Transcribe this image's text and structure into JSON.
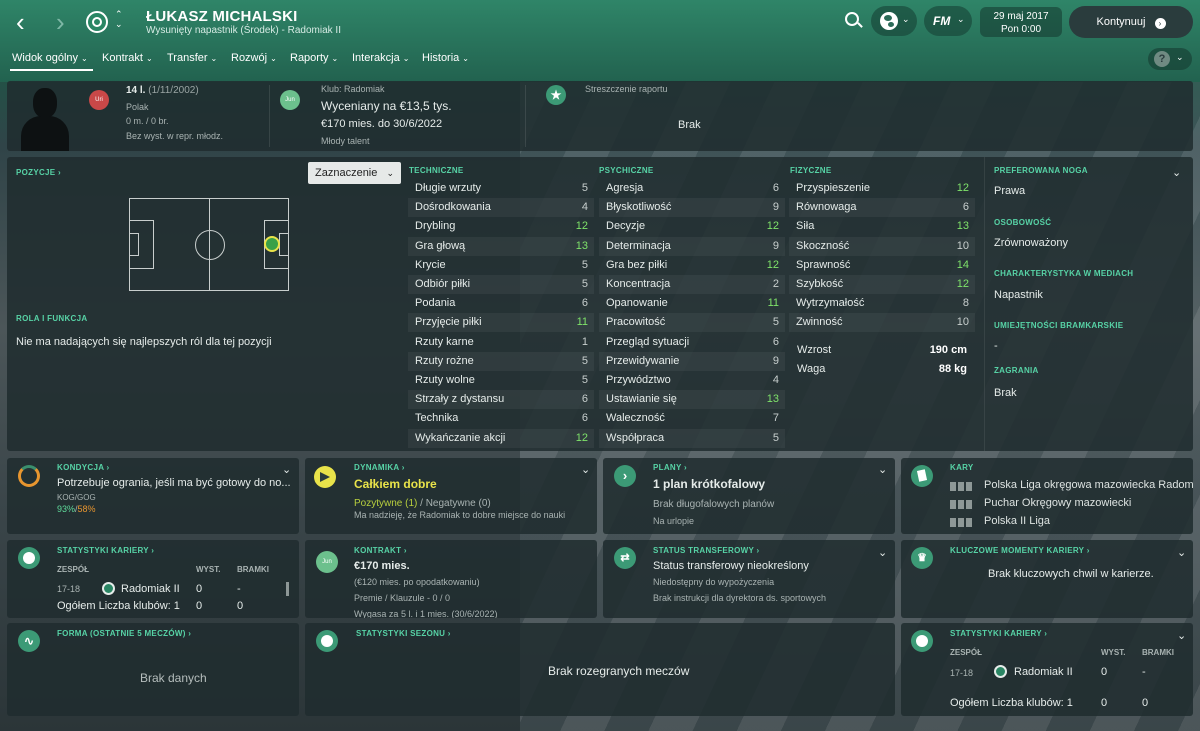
{
  "header": {
    "player_name": "ŁUKASZ MICHALSKI",
    "player_sub": "Wysunięty napastnik (Środek) - Radomiak II",
    "date_line1": "29 maj 2017",
    "date_line2": "Pon 0:00",
    "continue_label": "Kontynuuj",
    "fm_label": "FM"
  },
  "tabs": [
    "Widok ogólny",
    "Kontrakt",
    "Transfer",
    "Rozwój",
    "Raporty",
    "Interakcja",
    "Historia"
  ],
  "help_label": "?",
  "profile": {
    "uri_badge": "Uri",
    "age": "14 l.",
    "dob": "(1/11/2002)",
    "nationality": "Polak",
    "caps": "0 m. / 0 br.",
    "youth": "Bez wyst. w repr. młodz.",
    "jun_badge": "Jun",
    "club": "Klub: Radomiak",
    "value": "Wyceniany na €13,5 tys.",
    "wage": "€170 mies. do 30/6/2022",
    "talent": "Młody talent",
    "report_label": "Streszczenie raportu",
    "report_value": "Brak"
  },
  "positions": {
    "label": "POZYCJE",
    "dropdown": "Zaznaczenie",
    "role_label": "ROLA I FUNKCJA",
    "role_text": "Nie ma nadających się najlepszych ról dla tej pozycji"
  },
  "attributes": {
    "technical_label": "TECHNICZNE",
    "mental_label": "PSYCHICZNE",
    "physical_label": "FIZYCZNE",
    "technical": [
      {
        "n": "Długie wrzuty",
        "v": "5"
      },
      {
        "n": "Dośrodkowania",
        "v": "4"
      },
      {
        "n": "Drybling",
        "v": "12"
      },
      {
        "n": "Gra głową",
        "v": "13"
      },
      {
        "n": "Krycie",
        "v": "5"
      },
      {
        "n": "Odbiór piłki",
        "v": "5"
      },
      {
        "n": "Podania",
        "v": "6"
      },
      {
        "n": "Przyjęcie piłki",
        "v": "11"
      },
      {
        "n": "Rzuty karne",
        "v": "1"
      },
      {
        "n": "Rzuty rożne",
        "v": "5"
      },
      {
        "n": "Rzuty wolne",
        "v": "5"
      },
      {
        "n": "Strzały z dystansu",
        "v": "6"
      },
      {
        "n": "Technika",
        "v": "6"
      },
      {
        "n": "Wykańczanie akcji",
        "v": "12"
      }
    ],
    "mental": [
      {
        "n": "Agresja",
        "v": "6"
      },
      {
        "n": "Błyskotliwość",
        "v": "9"
      },
      {
        "n": "Decyzje",
        "v": "12"
      },
      {
        "n": "Determinacja",
        "v": "9"
      },
      {
        "n": "Gra bez piłki",
        "v": "12"
      },
      {
        "n": "Koncentracja",
        "v": "2"
      },
      {
        "n": "Opanowanie",
        "v": "11"
      },
      {
        "n": "Pracowitość",
        "v": "5"
      },
      {
        "n": "Przegląd sytuacji",
        "v": "6"
      },
      {
        "n": "Przewidywanie",
        "v": "9"
      },
      {
        "n": "Przywództwo",
        "v": "4"
      },
      {
        "n": "Ustawianie się",
        "v": "13"
      },
      {
        "n": "Waleczność",
        "v": "7"
      },
      {
        "n": "Współpraca",
        "v": "5"
      }
    ],
    "physical": [
      {
        "n": "Przyspieszenie",
        "v": "12"
      },
      {
        "n": "Równowaga",
        "v": "6"
      },
      {
        "n": "Siła",
        "v": "13"
      },
      {
        "n": "Skoczność",
        "v": "10"
      },
      {
        "n": "Sprawność",
        "v": "14"
      },
      {
        "n": "Szybkość",
        "v": "12"
      },
      {
        "n": "Wytrzymałość",
        "v": "8"
      },
      {
        "n": "Zwinność",
        "v": "10"
      }
    ],
    "height_label": "Wzrost",
    "height": "190 cm",
    "weight_label": "Waga",
    "weight": "88 kg"
  },
  "side": {
    "foot_label": "PREFEROWANA NOGA",
    "foot": "Prawa",
    "personality_label": "OSOBOWOŚĆ",
    "personality": "Zrównoważony",
    "media_label": "CHARAKTERYSTYKA W MEDIACH",
    "media": "Napastnik",
    "gk_label": "UMIEJĘTNOŚCI BRAMKARSKIE",
    "gk": "-",
    "plays_label": "ZAGRANIA",
    "plays": "Brak"
  },
  "cards": {
    "condition": {
      "label": "KONDYCJA",
      "text": "Potrzebuje ogrania, jeśli ma być gotowy do no...",
      "kog_label": "KOG/GOG",
      "kog_a": "93%",
      "kog_sep": "/",
      "kog_b": "58%"
    },
    "dynamics": {
      "label": "DYNAMIKA",
      "value": "Całkiem dobre",
      "pos": "Pozytywne (1)",
      "sep": "/",
      "neg": "Negatywne (0)",
      "note": "Ma nadzieję, że Radomiak to dobre miejsce do nauki"
    },
    "plans": {
      "label": "PLANY",
      "value": "1 plan krótkofalowy",
      "line1": "Brak długofalowych planów",
      "line2": "Na urlopie"
    },
    "cards_box": {
      "label": "KARY",
      "rows": [
        "Polska Liga okręgowa mazowiecka Radom",
        "Puchar Okręgowy mazowiecki",
        "Polska II Liga"
      ]
    },
    "career": {
      "label": "STATYSTYKI KARIERY",
      "col_team": "ZESPÓŁ",
      "col_apps": "WYST.",
      "col_goals": "BRAMKI",
      "season": "17-18",
      "club": "Radomiak II",
      "apps": "0",
      "goals": "-",
      "total_label": "Ogółem Liczba klubów: 1",
      "total_apps": "0",
      "total_goals": "0"
    },
    "contract": {
      "label": "KONTRAKT",
      "jun": "Jun",
      "value": "€170 mies.",
      "after_tax": "(€120 mies. po opodatkowaniu)",
      "premie": "Premie / Klauzule - 0 / 0",
      "expiry": "Wygasa za 5 l. i 1 mies. (30/6/2022)"
    },
    "transfer": {
      "label": "STATUS TRANSFEROWY",
      "value": "Status transferowy nieokreślony",
      "line1": "Niedostępny do wypożyczenia",
      "line2": "Brak instrukcji dla dyrektora ds. sportowych"
    },
    "moments": {
      "label": "KLUCZOWE MOMENTY KARIERY",
      "text": "Brak kluczowych chwil w karierze."
    },
    "form": {
      "label": "FORMA (OSTATNIE 5 MECZÓW)",
      "text": "Brak danych"
    },
    "season": {
      "label": "STATYSTYKI SEZONU",
      "text": "Brak rozegranych meczów"
    },
    "career2": {
      "label": "STATYSTYKI KARIERY",
      "col_team": "ZESPÓŁ",
      "col_apps": "WYST.",
      "col_goals": "BRAMKI",
      "season": "17-18",
      "club": "Radomiak II",
      "apps": "0",
      "goals": "-",
      "total_label": "Ogółem Liczba klubów: 1",
      "total_apps": "0",
      "total_goals": "0"
    }
  },
  "colors": {
    "accent": "#57d3a6",
    "highlight": "#7fe36a",
    "yellow": "#e9e34a",
    "orange": "#e8962f"
  }
}
